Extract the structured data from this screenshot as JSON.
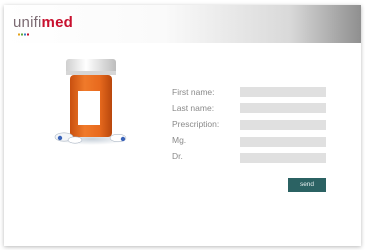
{
  "brand": {
    "logo_part1": "unifi",
    "logo_part2": "med",
    "accent_color": "#c8102e",
    "logo_gray": "#7b6a72"
  },
  "illustration": {
    "icon": "pill-bottle-icon",
    "cap_color": "#f2f2f2",
    "bottle_color": "#e86a1e",
    "label_color": "#ffffff"
  },
  "form": {
    "fields": [
      {
        "label": "First name:",
        "value": "",
        "placeholder": ""
      },
      {
        "label": "Last name:",
        "value": "",
        "placeholder": ""
      },
      {
        "label": "Prescription:",
        "value": "",
        "placeholder": ""
      },
      {
        "label": "Mg.",
        "value": "",
        "placeholder": ""
      },
      {
        "label": "Dr.",
        "value": "",
        "placeholder": ""
      }
    ],
    "submit_label": "send",
    "submit_color": "#2b6263",
    "field_color": "#e0e0e0"
  }
}
